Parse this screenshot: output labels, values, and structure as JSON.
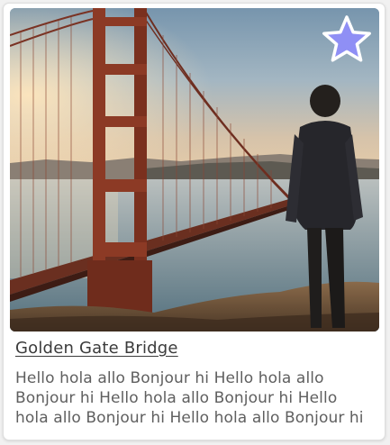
{
  "card": {
    "title": "Golden Gate Bridge",
    "description": "Hello hola allo Bonjour hi Hello hola allo Bonjour hi Hello hola allo Bonjour hi Hello hola allo Bonjour hi Hello hola allo Bonjour hi",
    "favorite": {
      "icon": "star-icon",
      "state": "active",
      "fill_color": "#8f8ff5"
    }
  }
}
